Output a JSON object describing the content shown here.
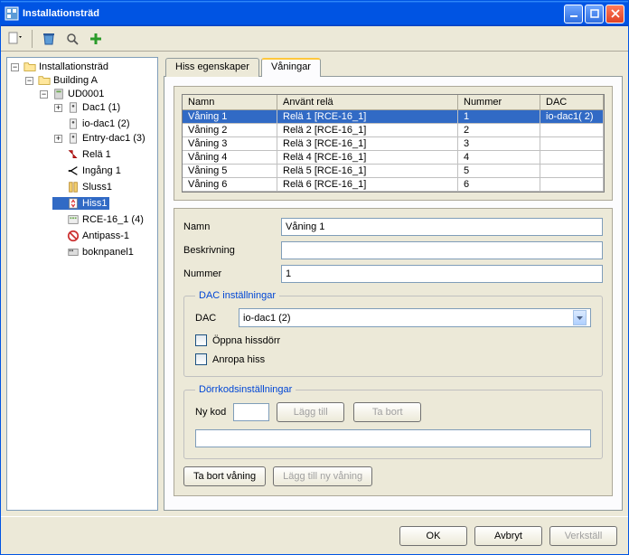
{
  "window": {
    "title": "Installationsträd"
  },
  "tree": {
    "root": "Installationsträd",
    "building": "Building A",
    "ud": "UD0001",
    "items": [
      "Dac1 (1)",
      "io-dac1 (2)",
      "Entry-dac1 (3)",
      "Relä 1",
      "Ingång 1",
      "Sluss1",
      "Hiss1",
      "RCE-16_1 (4)",
      "Antipass-1",
      "boknpanel1"
    ],
    "selected_index": 6
  },
  "tabs": {
    "t0": "Hiss egenskaper",
    "t1": "Våningar"
  },
  "grid": {
    "headers": {
      "c0": "Namn",
      "c1": "Använt relä",
      "c2": "Nummer",
      "c3": "DAC"
    },
    "rows": [
      {
        "c0": "Våning 1",
        "c1": "Relä 1 [RCE-16_1]",
        "c2": "1",
        "c3": "io-dac1( 2)"
      },
      {
        "c0": "Våning 2",
        "c1": "Relä 2 [RCE-16_1]",
        "c2": "2",
        "c3": ""
      },
      {
        "c0": "Våning 3",
        "c1": "Relä 3 [RCE-16_1]",
        "c2": "3",
        "c3": ""
      },
      {
        "c0": "Våning 4",
        "c1": "Relä 4 [RCE-16_1]",
        "c2": "4",
        "c3": ""
      },
      {
        "c0": "Våning 5",
        "c1": "Relä 5 [RCE-16_1]",
        "c2": "5",
        "c3": ""
      },
      {
        "c0": "Våning 6",
        "c1": "Relä 6 [RCE-16_1]",
        "c2": "6",
        "c3": ""
      }
    ]
  },
  "form": {
    "namn_label": "Namn",
    "namn_value": "Våning 1",
    "beskr_label": "Beskrivning",
    "beskr_value": "",
    "nummer_label": "Nummer",
    "nummer_value": "1"
  },
  "dac_group": {
    "legend": "DAC inställningar",
    "dac_label": "DAC",
    "dac_value": "io-dac1 (2)",
    "open_label": "Öppna hissdörr",
    "call_label": "Anropa hiss"
  },
  "door_group": {
    "legend": "Dörrkodsinställningar",
    "newcode_label": "Ny kod",
    "add_label": "Lägg till",
    "remove_label": "Ta bort"
  },
  "bottom": {
    "delete_floor": "Ta bort våning",
    "add_floor": "Lägg till ny våning"
  },
  "footer": {
    "ok": "OK",
    "cancel": "Avbryt",
    "apply": "Verkställ"
  }
}
